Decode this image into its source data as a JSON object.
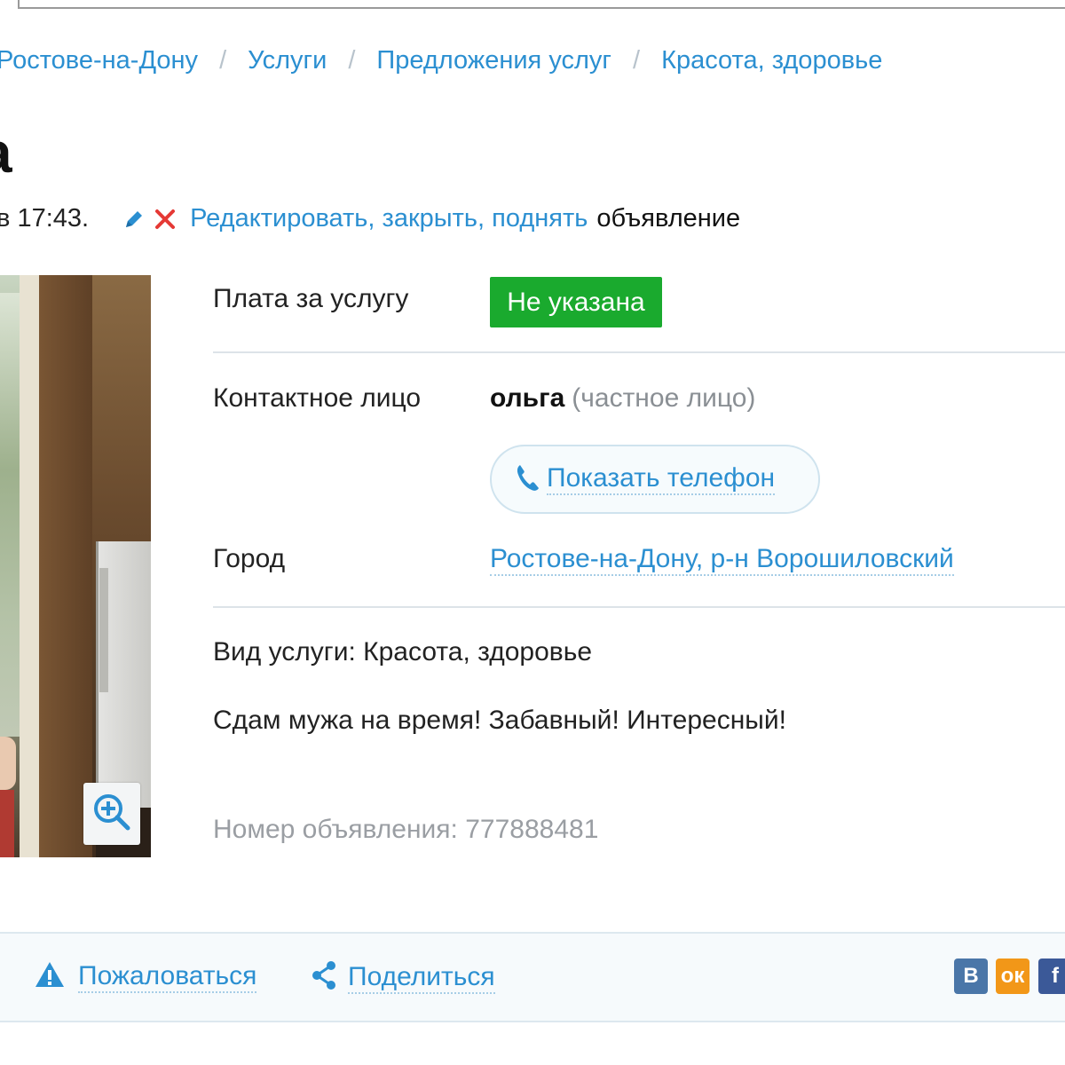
{
  "breadcrumb": {
    "items": [
      "Ростове-на-Дону",
      "Услуги",
      "Предложения услуг",
      "Красота, здоровье"
    ],
    "separator": "/"
  },
  "title": {
    "text": "а"
  },
  "meta": {
    "time_text": "в 17:43.",
    "links_text": "Редактировать, закрыть, поднять",
    "suffix": "объявление"
  },
  "details": {
    "price_label": "Плата за услугу",
    "price_value": "Не указана",
    "contact_label": "Контактное лицо",
    "contact_name": "ольга",
    "contact_role": "(частное лицо)",
    "phone_button": "Показать телефон",
    "city_label": "Город",
    "city_value": "Ростове-на-Дону, р-н Ворошиловский"
  },
  "description": {
    "service_type": "Вид услуги: Красота, здоровье",
    "text": "Сдам мужа на время! Забавный! Интересный!",
    "ad_number": "Номер объявления: 777888481"
  },
  "footer": {
    "report": "Пожаловаться",
    "share": "Поделиться",
    "social": [
      "В",
      "ок",
      "f"
    ]
  },
  "colors": {
    "link": "#2b8fd1",
    "price_badge": "#1aaa2e",
    "warning_icon": "#2b8fd1",
    "close_icon": "#e53935"
  },
  "icons": [
    "pencil-icon",
    "close-icon",
    "zoom-in-icon",
    "phone-icon",
    "warning-icon",
    "share-icon"
  ]
}
